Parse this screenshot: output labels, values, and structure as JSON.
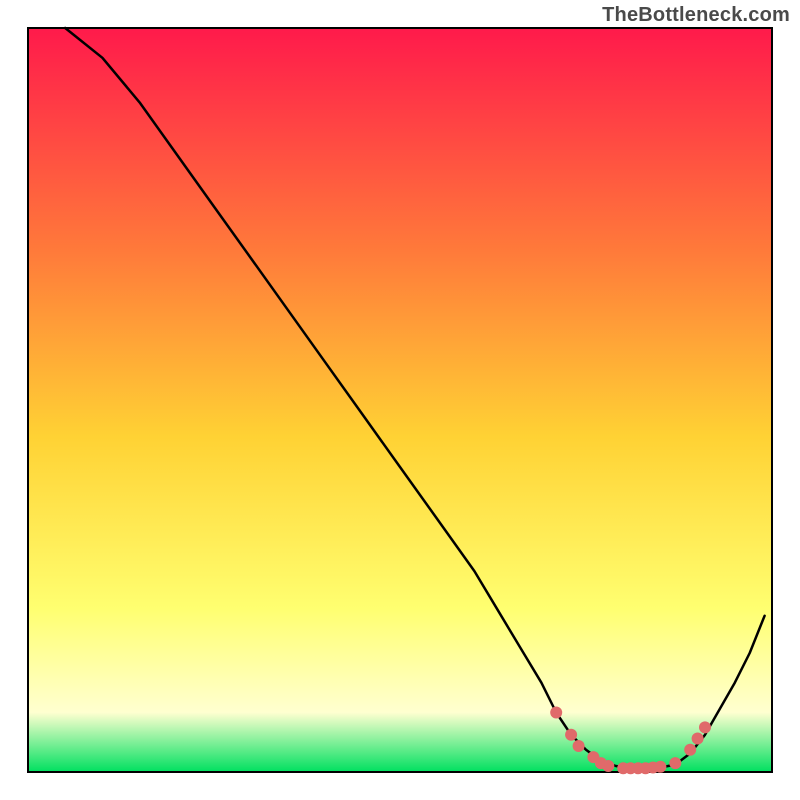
{
  "watermark": "TheBottleneck.com",
  "colors": {
    "gradient_top": "#ff1a4b",
    "gradient_mid1": "#ff7a3a",
    "gradient_mid2": "#ffd234",
    "gradient_low": "#ffff70",
    "gradient_pale": "#ffffd0",
    "gradient_bottom": "#00e060",
    "curve": "#000000",
    "dots": "#e06a6a",
    "border": "#000000"
  },
  "chart_data": {
    "type": "line",
    "title": "",
    "xlabel": "",
    "ylabel": "",
    "xlim": [
      0,
      100
    ],
    "ylim": [
      0,
      100
    ],
    "x": [
      5,
      10,
      15,
      20,
      25,
      30,
      35,
      40,
      45,
      50,
      55,
      60,
      63,
      66,
      69,
      71,
      73,
      75,
      77,
      79,
      81,
      83,
      85,
      87,
      89,
      91,
      93,
      95,
      97,
      99
    ],
    "values": [
      100,
      96,
      90,
      83,
      76,
      69,
      62,
      55,
      48,
      41,
      34,
      27,
      22,
      17,
      12,
      8,
      5,
      3,
      1.5,
      0.8,
      0.5,
      0.5,
      0.6,
      1,
      2.5,
      5,
      8.5,
      12,
      16,
      21
    ],
    "dot_points": [
      {
        "x": 71,
        "y": 8
      },
      {
        "x": 73,
        "y": 5
      },
      {
        "x": 74,
        "y": 3.5
      },
      {
        "x": 76,
        "y": 2
      },
      {
        "x": 77,
        "y": 1.2
      },
      {
        "x": 78,
        "y": 0.8
      },
      {
        "x": 80,
        "y": 0.5
      },
      {
        "x": 81,
        "y": 0.5
      },
      {
        "x": 82,
        "y": 0.5
      },
      {
        "x": 83,
        "y": 0.5
      },
      {
        "x": 84,
        "y": 0.6
      },
      {
        "x": 85,
        "y": 0.7
      },
      {
        "x": 87,
        "y": 1.2
      },
      {
        "x": 89,
        "y": 3
      },
      {
        "x": 90,
        "y": 4.5
      },
      {
        "x": 91,
        "y": 6
      }
    ]
  }
}
